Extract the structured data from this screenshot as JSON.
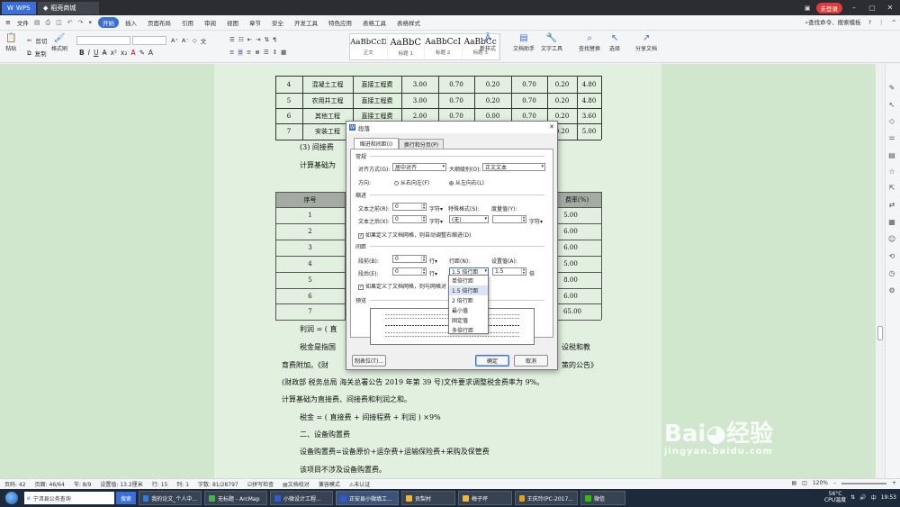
{
  "titlebar": {
    "tabs": [
      {
        "label": "WPS"
      },
      {
        "label": "稻壳商城"
      }
    ],
    "login": "未登录"
  },
  "menubar": {
    "file": "文件",
    "items": [
      "开始",
      "插入",
      "页面布局",
      "引用",
      "审阅",
      "视图",
      "章节",
      "安全",
      "开发工具",
      "特色应用",
      "表格工具",
      "表格样式"
    ],
    "active": "开始",
    "search": "查找命令、搜索模板"
  },
  "ribbon": {
    "paste": "粘贴",
    "cut": "剪切",
    "copy": "复制",
    "format_painter": "格式刷",
    "styles": [
      {
        "sample": "AaBbCcDd",
        "name": "正文"
      },
      {
        "sample": "AaBbC",
        "name": "标题 1"
      },
      {
        "sample": "AaBbCcI",
        "name": "标题 2"
      },
      {
        "sample": "AaBbCc",
        "name": "标题 3"
      }
    ],
    "new_style": "新样式",
    "doc_helper": "文档助手",
    "text_tools": "文字工具",
    "find_replace": "查找替换",
    "select": "选择",
    "share": "分享文档"
  },
  "doc": {
    "table_top": [
      [
        "4",
        "混凝土工程",
        "直接工程费",
        "3.00",
        "0.70",
        "0.20",
        "0.70",
        "0.20",
        "4.80"
      ],
      [
        "5",
        "农用井工程",
        "直接工程费",
        "3.00",
        "0.70",
        "0.20",
        "0.70",
        "0.20",
        "4.80"
      ],
      [
        "6",
        "其他工程",
        "直接工程费",
        "2.00",
        "0.70",
        "0.00",
        "0.70",
        "0.20",
        "3.60"
      ],
      [
        "7",
        "安装工程",
        "",
        "",
        "",
        "",
        "",
        "0.20",
        "5.00"
      ]
    ],
    "line1": "(3) 间接费",
    "line2": "计算基础为",
    "table2_headers": {
      "left": "序号",
      "right": "费率(%)"
    },
    "table2_rows": [
      {
        "n": "1",
        "v": "5.00"
      },
      {
        "n": "2",
        "v": "6.00"
      },
      {
        "n": "3",
        "v": "6.00"
      },
      {
        "n": "4",
        "v": "5.00"
      },
      {
        "n": "5",
        "v": "8.00"
      },
      {
        "n": "6",
        "v": "6.00"
      },
      {
        "n": "7",
        "v": "65.00"
      }
    ],
    "profit_line": "利润 = ( 直",
    "para1_a": "税金是指国",
    "para1_b": "设税和教",
    "para2_a": "育费附加。《财",
    "para2_b": "策的公告》",
    "para3": "(财政部  税务总局  海关总署公告 2019 年第 39 号)文件要求调整税金费率为 9%。",
    "para4": "计算基础为直接费、间接费和利润之和。",
    "formula": "税金 = ( 直接费 + 间接程费 + 利润 ) ×9%",
    "heading": "二、设备购置费",
    "para5": "设备购置费=设备原价+运杂费+运输保险费+采购及保管费",
    "para6": "该项目不涉及设备购置费。"
  },
  "dialog": {
    "title": "段落",
    "tabs": [
      "缩进和间距(I)",
      "换行和分页(P)"
    ],
    "general": "常规",
    "align_label": "对齐方式(G):",
    "align_value": "居中对齐",
    "outline_label": "大纲级别(O):",
    "outline_value": "正文文本",
    "direction_label": "方向:",
    "rtl": "从右向左(F)",
    "ltr": "从左向右(L)",
    "indent": "缩进",
    "before_text_label": "文本之前(R):",
    "before_text_value": "0",
    "after_text_label": "文本之后(X):",
    "after_text_value": "0",
    "unit_char": "字符",
    "special_label": "特殊格式(S):",
    "special_value": "(无)",
    "measure_label": "度量值(Y):",
    "measure_value": "",
    "chk_grid_indent": "如果定义了文档网格，则自动调整右缩进(D)",
    "spacing": "间距",
    "before_label": "段前(B):",
    "before_value": "0",
    "after_label": "段后(E):",
    "after_value": "0",
    "unit_line": "行",
    "line_spacing_label": "行距(N):",
    "line_spacing_value": "1.5 倍行距",
    "setting_label": "设置值(A):",
    "setting_value": "1.5",
    "unit_times": "倍",
    "chk_grid_align": "如果定义了文档网格，则与网格对",
    "preview": "预览",
    "tabs_button": "制表位(T)...",
    "ok": "确定",
    "cancel": "取消",
    "dropdown_options": [
      "单倍行距",
      "1.5 倍行距",
      "2 倍行距",
      "最小值",
      "固定值",
      "多倍行距"
    ],
    "dropdown_selected": "1.5 倍行距"
  },
  "status": {
    "page": "页码: 42",
    "pages": "页面: 46/64",
    "section": "节: 8/9",
    "setting": "设置值: 13.2厘米",
    "row": "行: 15",
    "col": "列: 1",
    "words": "字数: 81/28797",
    "spell": "拼写检查",
    "proof": "文档校对",
    "compat": "兼容模式",
    "cert": "未认证",
    "zoom": "120%"
  },
  "taskbar": {
    "search_placeholder": "宁洱县公务查询",
    "search_btn": "搜索",
    "tasks": [
      "我的论文_个人中...",
      "无标题 - ArcMap",
      "小微设计工程...",
      "正安县小微填工...",
      "贡梨村",
      "梅子坪",
      "王庆玲(PC-2017...",
      "微信"
    ],
    "temp": "56°C",
    "cpu": "CPU温度",
    "time": "19:53"
  },
  "watermark": {
    "brand": "Bai",
    "brand2": "经验",
    "url": "jingyan.baidu.com"
  }
}
